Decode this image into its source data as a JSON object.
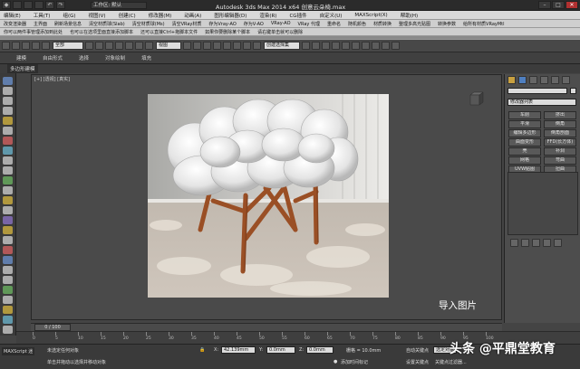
{
  "title_bar": {
    "workspace": "工作区: 默认",
    "title": "Autodesk 3ds Max  2014 x64      创意云朵椅.max"
  },
  "menu": [
    "编辑(E)",
    "工具(T)",
    "组(G)",
    "视图(V)",
    "创建(C)",
    "修改器(M)",
    "动画(A)",
    "图形编辑器(D)",
    "渲染(R)",
    "CG插件",
    "自定义(U)",
    "MAXScript(X)",
    "帮助(H)"
  ],
  "plugin_row1": [
    "改变渲染器",
    "主界面",
    "刷新场景信息",
    "清空材质球(Slab)",
    "清空材质球(Ms)",
    "清空VRay材质",
    "存为Vray-AO",
    "存为V-AO",
    "VRay-AO",
    "VRay 代理",
    "重命名",
    "随机颜色",
    "材质转换",
    "整理多高光贴图",
    "转换参数",
    "给所有材质VRayMtl"
  ],
  "plugin_row2": [
    "你可以两件事管理添加到此处",
    "也可以在选项里面直接添加脚本",
    "还可以直接Ctrl+拖脚本文件",
    "如果你要删除某个脚本",
    "请右键单击就可以删除"
  ],
  "toolbar": {
    "selection_filter": "全部",
    "ref_coord": "视图",
    "named_selection": "创建选择集"
  },
  "ribbon_tabs": [
    "建模",
    "自由形式",
    "选择",
    "对象绘制",
    "填充"
  ],
  "subribbon": "多边形建模",
  "viewport": {
    "label": "[+] [透视] [真实]",
    "caption": "导入图片"
  },
  "command_panel": {
    "dropdown": "修改器列表",
    "buttons": [
      "车削",
      "挤出",
      "平滑",
      "倒角",
      "编辑多边形",
      "倒角剖面",
      "曲面变形",
      "FFD(长方体)",
      "壳",
      "补洞",
      "网格",
      "弯曲",
      "UVW贴图",
      "扭曲"
    ]
  },
  "timeline": {
    "frame": "0 / 100",
    "ticks": [
      "0",
      "5",
      "10",
      "15",
      "20",
      "25",
      "30",
      "35",
      "40",
      "45",
      "50",
      "55",
      "60",
      "65",
      "70",
      "75",
      "80",
      "85",
      "90",
      "95",
      "100"
    ]
  },
  "status": {
    "maxscript": "MAXScript 迷",
    "selection": "未选定任何对象",
    "prompt": "单击并拖动以选择并移动对象",
    "x_label": "X:",
    "x_value": "42.139mm",
    "y_label": "Y:",
    "y_value": "0.0mm",
    "z_label": "Z:",
    "z_value": "0.0mm",
    "grid": "栅格 = 10.0mm",
    "add_time_tag": "添加时间标记",
    "auto_key": "自动关键点",
    "selected_object": "选定对象",
    "set_key": "设置关键点",
    "key_filter": "关键点过滤器..."
  },
  "watermark": "头条 @平鼎堂教育"
}
